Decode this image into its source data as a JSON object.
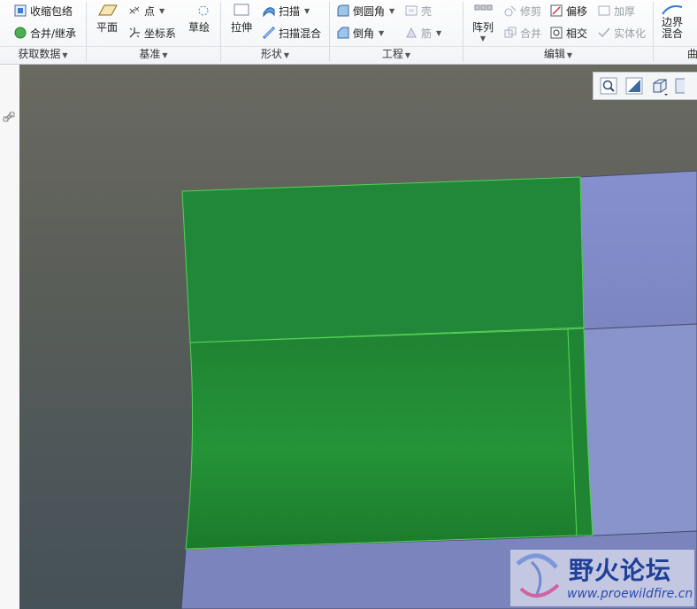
{
  "ribbon": {
    "groups": [
      {
        "label": "获取数据",
        "items": [
          "收缩包络",
          "合并/继承"
        ]
      },
      {
        "label": "基准",
        "items": [
          "平面",
          "点",
          "坐标系",
          "草绘"
        ]
      },
      {
        "label": "形状",
        "items": [
          "拉伸",
          "扫描",
          "扫描混合"
        ]
      },
      {
        "label": "工程",
        "items": [
          "倒圆角",
          "倒角",
          "壳",
          "筋"
        ]
      },
      {
        "label": "编辑",
        "items": [
          "阵列",
          "修剪",
          "合并",
          "偏移",
          "相交",
          "加厚",
          "实体化"
        ]
      },
      {
        "label": "曲",
        "items": [
          "边界混合"
        ]
      }
    ]
  },
  "watermark": {
    "title": "野火论坛",
    "url": "www.proewildfire.cn"
  },
  "colors": {
    "green_surface": "#228a34",
    "blue_surface": "#8a94cd",
    "edge_highlight": "#4ccf4c"
  }
}
